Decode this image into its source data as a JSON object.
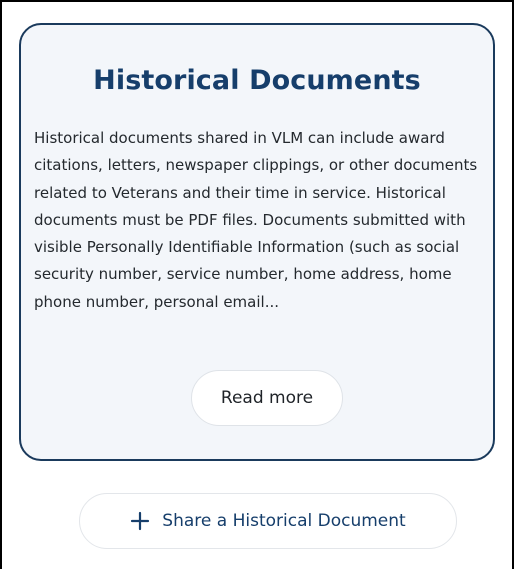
{
  "card": {
    "title": "Historical Documents",
    "description": "Historical documents shared in VLM can include award citations, letters, newspaper clippings, or other documents related to Veterans and their time in service. Historical documents must be PDF files. Documents submitted with visible Personally Identifiable Information (such as social security number, service number, home address, home phone number, personal email...",
    "read_more_label": "Read more"
  },
  "actions": {
    "share_label": "Share a Historical Document",
    "share_icon": "plus-icon"
  },
  "colors": {
    "title": "#163e6b",
    "card_border": "#1a3a5c",
    "card_background": "#f3f6fa"
  }
}
